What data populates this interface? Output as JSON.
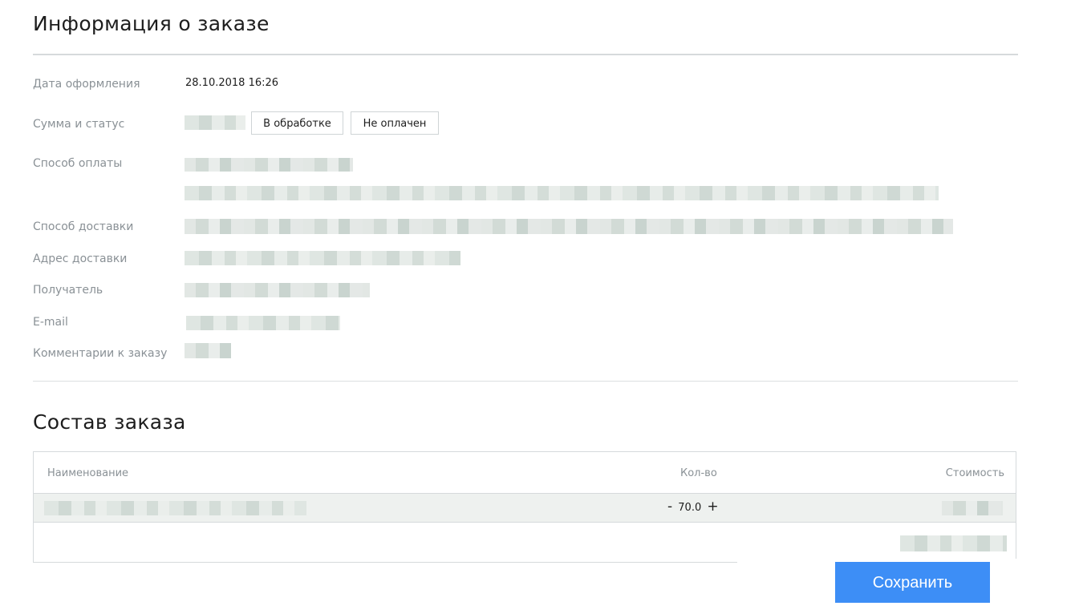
{
  "order_info": {
    "title": "Информация о заказе",
    "fields": {
      "date_label": "Дата оформления",
      "date_value": "28.10.2018 16:26",
      "sum_status_label": "Сумма и статус",
      "status_processing": "В обработке",
      "status_payment": "Не оплачен",
      "payment_method_label": "Способ оплаты",
      "delivery_method_label": "Способ доставки",
      "delivery_address_label": "Адрес доставки",
      "recipient_label": "Получатель",
      "email_label": "E-mail",
      "comment_label": "Комментарии к заказу"
    }
  },
  "order_contents": {
    "title": "Состав заказа",
    "columns": {
      "name": "Наименование",
      "quantity": "Кол-во",
      "cost": "Стоимость"
    },
    "rows": [
      {
        "quantity": "70.0",
        "decrement": "-",
        "increment": "+"
      }
    ]
  },
  "actions": {
    "save_label": "Сохранить"
  },
  "colors": {
    "accent": "#3d8ef6",
    "row_background": "#eef1ef",
    "label_text": "#8a9196"
  }
}
